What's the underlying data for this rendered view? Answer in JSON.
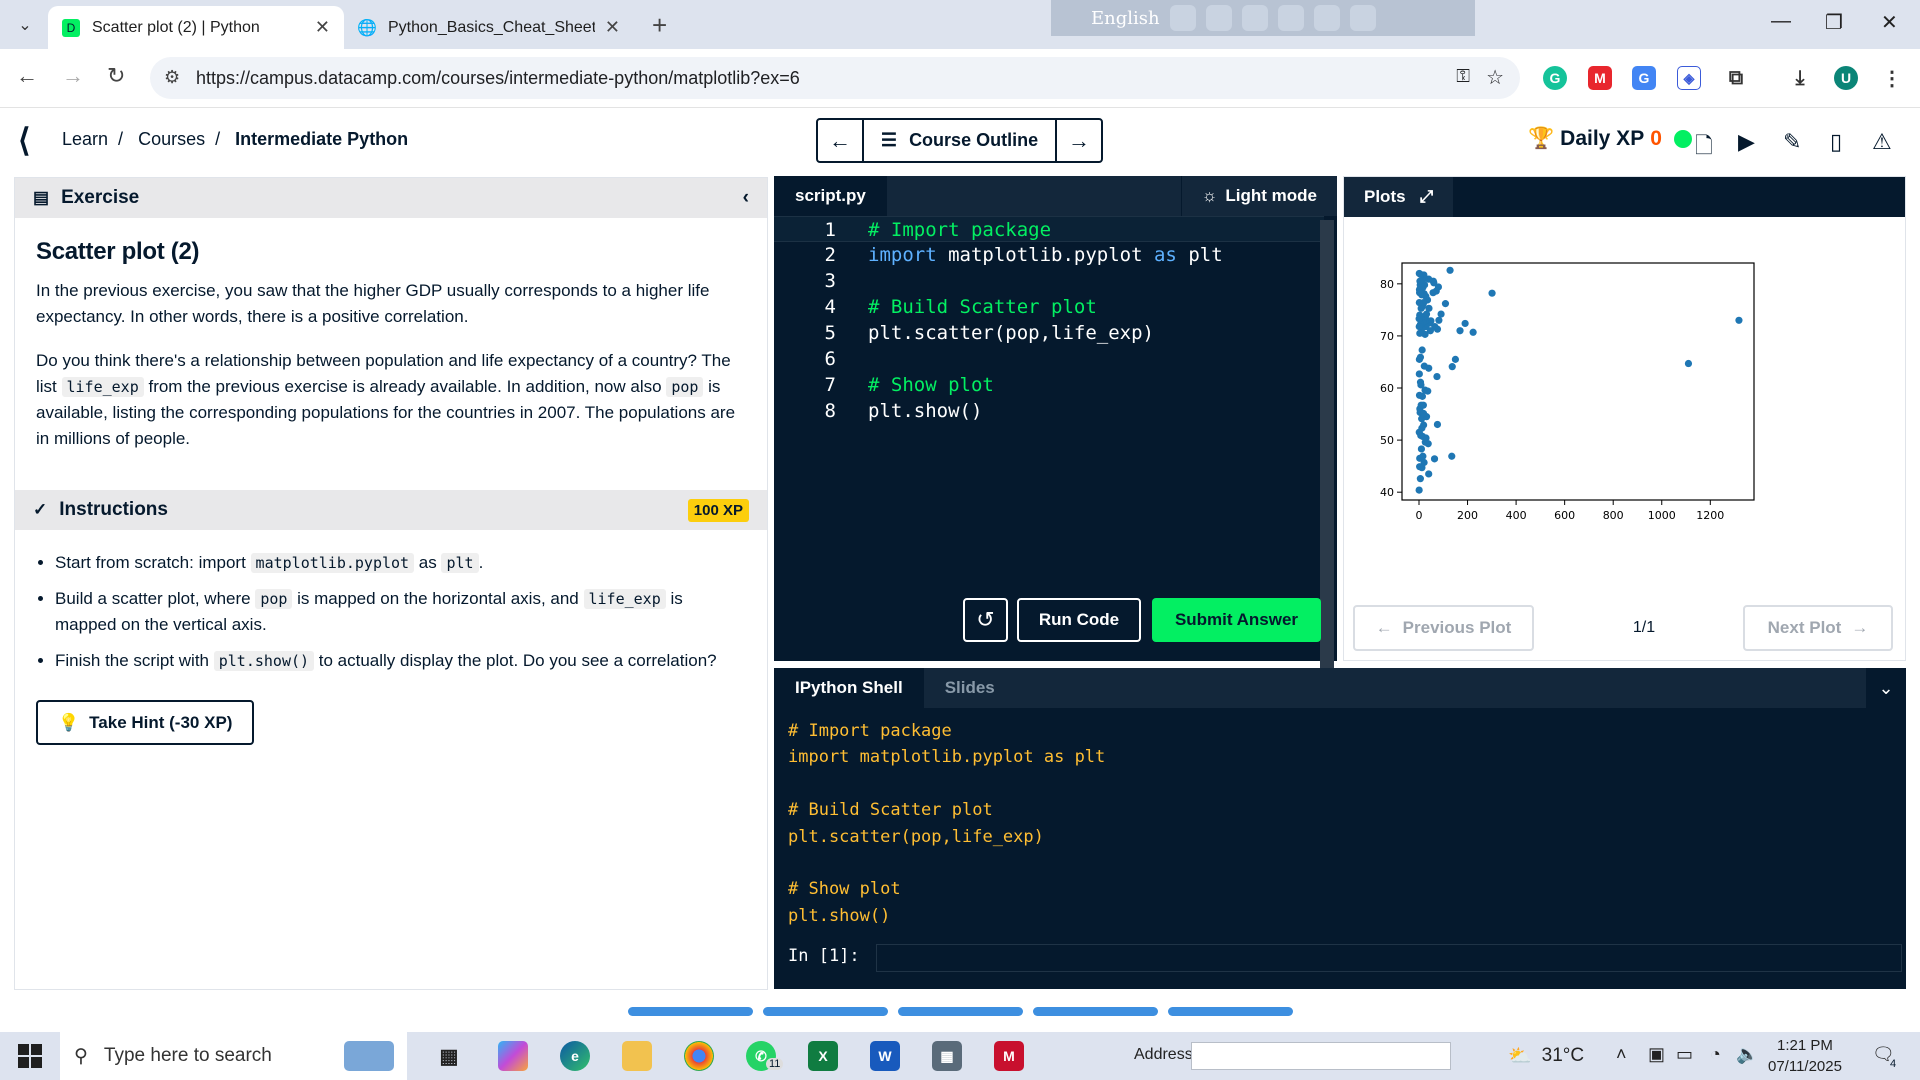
{
  "browser": {
    "tabs": [
      {
        "title": "Scatter plot (2) | Python",
        "active": true
      },
      {
        "title": "Python_Basics_Cheat_Sheet-up",
        "active": false
      }
    ],
    "language_bar": "English",
    "url": "https://campus.datacamp.com/courses/intermediate-python/matplotlib?ex=6"
  },
  "header": {
    "breadcrumbs": [
      "Learn",
      "Courses",
      "Intermediate Python"
    ],
    "course_outline": "Course Outline",
    "daily_xp_label": "Daily XP",
    "daily_xp_value": "0"
  },
  "exercise": {
    "section_label": "Exercise",
    "title": "Scatter plot (2)",
    "para1": "In the previous exercise, you saw that the higher GDP usually corresponds to a higher life expectancy. In other words, there is a positive correlation.",
    "para2_a": "Do you think there's a relationship between population and life expectancy of a country? The list ",
    "para2_code1": "life_exp",
    "para2_b": " from the previous exercise is already available. In addition, now also ",
    "para2_code2": "pop",
    "para2_c": " is available, listing the corresponding populations for the countries in 2007. The populations are in millions of people."
  },
  "instructions": {
    "label": "Instructions",
    "xp": "100 XP",
    "items": [
      {
        "a": "Start from scratch: import ",
        "c1": "matplotlib.pyplot",
        "b": " as ",
        "c2": "plt",
        "d": "."
      },
      {
        "a": "Build a scatter plot, where ",
        "c1": "pop",
        "b": " is mapped on the horizontal axis, and ",
        "c2": "life_exp",
        "d": " is mapped on the vertical axis."
      },
      {
        "a": "Finish the script with ",
        "c1": "plt.show()",
        "b": " to actually display the plot. Do you see a correlation?"
      }
    ],
    "hint_button": "Take Hint (-30 XP)"
  },
  "editor": {
    "tab": "script.py",
    "light_mode": "Light mode",
    "lines": [
      {
        "n": "1",
        "parts": [
          {
            "t": "# Import package",
            "c": "c-com"
          }
        ]
      },
      {
        "n": "2",
        "parts": [
          {
            "t": "import",
            "c": "c-kw"
          },
          {
            "t": " matplotlib.pyplot ",
            "c": ""
          },
          {
            "t": "as",
            "c": "c-kw"
          },
          {
            "t": " plt",
            "c": ""
          }
        ]
      },
      {
        "n": "3",
        "parts": []
      },
      {
        "n": "4",
        "parts": [
          {
            "t": "# Build Scatter plot",
            "c": "c-com"
          }
        ]
      },
      {
        "n": "5",
        "parts": [
          {
            "t": "plt.scatter(pop,life_exp)",
            "c": ""
          }
        ]
      },
      {
        "n": "6",
        "parts": []
      },
      {
        "n": "7",
        "parts": [
          {
            "t": "# Show plot",
            "c": "c-com"
          }
        ]
      },
      {
        "n": "8",
        "parts": [
          {
            "t": "plt.show()",
            "c": ""
          }
        ]
      }
    ],
    "run_code": "Run Code",
    "submit": "Submit Answer"
  },
  "plots": {
    "tab": "Plots",
    "previous": "Previous Plot",
    "next": "Next Plot",
    "count": "1/1"
  },
  "chart_data": {
    "type": "scatter",
    "xlim": [
      -70,
      1380
    ],
    "ylim": [
      38.5,
      84
    ],
    "xticks": [
      0,
      200,
      400,
      600,
      800,
      1000,
      1200
    ],
    "yticks": [
      40,
      50,
      60,
      70,
      80
    ],
    "color": "#1f77b4",
    "points": [
      [
        1318,
        73
      ],
      [
        1110,
        64.7
      ],
      [
        301,
        78.2
      ],
      [
        190,
        72.4
      ],
      [
        223,
        70.7
      ],
      [
        169,
        71
      ],
      [
        150,
        65.5
      ],
      [
        137,
        64.1
      ],
      [
        128,
        82.6
      ],
      [
        109,
        76.2
      ],
      [
        91,
        74.2
      ],
      [
        80,
        79.4
      ],
      [
        82,
        73
      ],
      [
        76,
        71.3
      ],
      [
        71,
        78.6
      ],
      [
        65,
        71.8
      ],
      [
        61,
        80.2
      ],
      [
        59,
        80.5
      ],
      [
        58,
        78.3
      ],
      [
        49,
        72.9
      ],
      [
        47,
        71
      ],
      [
        45,
        72.5
      ],
      [
        41,
        75.3
      ],
      [
        40,
        80.9
      ],
      [
        35,
        76.9
      ],
      [
        33,
        73
      ],
      [
        31,
        74.2
      ],
      [
        29,
        71.8
      ],
      [
        28,
        77.6
      ],
      [
        27,
        73.9
      ],
      [
        25,
        70.3
      ],
      [
        24,
        72.8
      ],
      [
        23,
        79.8
      ],
      [
        22,
        81.2
      ],
      [
        21,
        78.1
      ],
      [
        20,
        81.7
      ],
      [
        19,
        76.4
      ],
      [
        18,
        73.1
      ],
      [
        17,
        76.1
      ],
      [
        16,
        79.3
      ],
      [
        15,
        72.6
      ],
      [
        14,
        80.6
      ],
      [
        13,
        75.6
      ],
      [
        12,
        71.4
      ],
      [
        11,
        77.9
      ],
      [
        10,
        79.4
      ],
      [
        9,
        75.3
      ],
      [
        8,
        73.7
      ],
      [
        7,
        81.8
      ],
      [
        6,
        72.2
      ],
      [
        5,
        79.8
      ],
      [
        4,
        80.5
      ],
      [
        3,
        74
      ],
      [
        2,
        78.9
      ],
      [
        1.5,
        76.4
      ],
      [
        1,
        71.8
      ],
      [
        0.5,
        73.3
      ],
      [
        3.5,
        70.5
      ],
      [
        2.5,
        78.3
      ],
      [
        1.2,
        82
      ],
      [
        74,
        62.2
      ],
      [
        40,
        63.8
      ],
      [
        13,
        67.3
      ],
      [
        22,
        64.2
      ],
      [
        6,
        65.9
      ],
      [
        8,
        60.6
      ],
      [
        25,
        59.6
      ],
      [
        18,
        56.7
      ],
      [
        1.4,
        62.7
      ],
      [
        14,
        58.4
      ],
      [
        3.6,
        56
      ],
      [
        11,
        54.1
      ],
      [
        31,
        54.5
      ],
      [
        19,
        52.9
      ],
      [
        12,
        52.3
      ],
      [
        76,
        53
      ],
      [
        1.1,
        51.5
      ],
      [
        15,
        50.7
      ],
      [
        29,
        50.4
      ],
      [
        10,
        48.3
      ],
      [
        38,
        49.3
      ],
      [
        3.1,
        46.5
      ],
      [
        16,
        46.9
      ],
      [
        12,
        44.7
      ],
      [
        5.7,
        42.6
      ],
      [
        135,
        46.9
      ],
      [
        0.6,
        40.4
      ],
      [
        64,
        46.4
      ],
      [
        40,
        43.5
      ],
      [
        21,
        45.7
      ],
      [
        6.2,
        61.1
      ],
      [
        9.1,
        56.7
      ],
      [
        2.1,
        58.6
      ],
      [
        4.6,
        55.3
      ],
      [
        7.3,
        50.9
      ],
      [
        19,
        55.1
      ],
      [
        26,
        49.6
      ],
      [
        36,
        59.4
      ],
      [
        1.6,
        65.5
      ],
      [
        2.7,
        44.9
      ]
    ]
  },
  "shell": {
    "tabs": [
      "IPython Shell",
      "Slides"
    ],
    "lines": [
      "# Import package",
      "import matplotlib.pyplot as plt",
      "",
      "# Build Scatter plot",
      "plt.scatter(pop,life_exp)",
      "",
      "# Show plot",
      "plt.show()"
    ],
    "prompt": "In [1]:"
  },
  "taskbar": {
    "search_placeholder": "Type here to search",
    "address_label": "Address",
    "temperature": "31°C",
    "time": "1:21 PM",
    "date": "07/11/2025",
    "whatsapp_badge": "11",
    "notification_count": "4"
  }
}
